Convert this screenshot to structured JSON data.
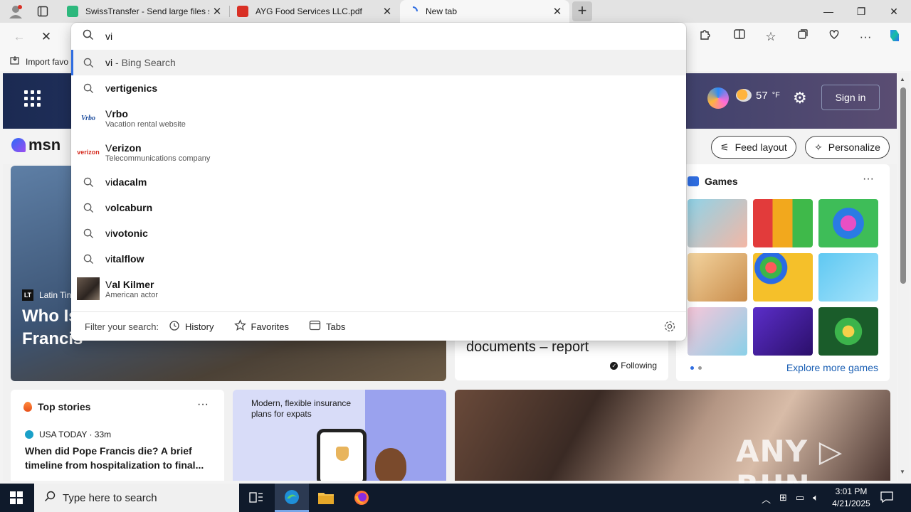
{
  "tabs": [
    {
      "title": "SwissTransfer - Send large files se",
      "close": "✕"
    },
    {
      "title": "AYG Food Services LLC.pdf",
      "close": "✕"
    },
    {
      "title": "New tab",
      "close": "✕"
    }
  ],
  "new_tab_glyph": "+",
  "window_controls": {
    "minimize": "—",
    "maximize": "❐",
    "close": "✕"
  },
  "favorites_bar": {
    "import_label": "Import favo"
  },
  "omnibox": {
    "value": "vi",
    "suggestions": [
      {
        "kind": "search",
        "bold": "vi",
        "rest": " - Bing Search"
      },
      {
        "kind": "search",
        "prefix": "v",
        "bold": "ertigenics"
      },
      {
        "kind": "site",
        "prefix": "V",
        "bold": "rbo",
        "sub": "Vacation rental website",
        "brand": "Vrbo"
      },
      {
        "kind": "site",
        "prefix": "V",
        "bold": "erizon",
        "sub": "Telecommunications company",
        "brand": "verizon"
      },
      {
        "kind": "search",
        "prefix": "vi",
        "bold": "dacalm"
      },
      {
        "kind": "search",
        "prefix": "v",
        "bold": "olcaburn"
      },
      {
        "kind": "search",
        "prefix": "vi",
        "bold": "votonic"
      },
      {
        "kind": "search",
        "prefix": "vi",
        "bold": "talflow"
      },
      {
        "kind": "person",
        "prefix": "V",
        "bold": "al Kilmer",
        "sub": "American actor"
      }
    ],
    "filter": {
      "label": "Filter your search:",
      "history": "History",
      "favorites": "Favorites",
      "tabs": "Tabs"
    }
  },
  "msn": {
    "logo": "msn",
    "weather": "57",
    "weather_unit": "°F",
    "sign_in": "Sign in",
    "feed_layout": "Feed layout",
    "personalize": "Personalize",
    "hero": {
      "source": "Latin Tin",
      "headline": "Who Is ... Preferred Candidate To Succeed Pope Francis"
    },
    "mid_card": {
      "title": "documents – report",
      "following": "Following"
    },
    "games": {
      "title": "Games",
      "more": "···",
      "explore": "Explore more games"
    },
    "top_stories": {
      "title": "Top stories",
      "more": "···",
      "source": "USA TODAY · 33m",
      "headline": "When did Pope Francis die? A brief timeline from hospitalization to final..."
    },
    "ad": {
      "text": "Modern, flexible insurance plans for expats"
    },
    "watermark": "ANY ▷ RUN"
  },
  "taskbar": {
    "search_placeholder": "Type here to search",
    "time": "3:01 PM",
    "date": "4/21/2025"
  },
  "colors": {
    "accent": "#2f6de1",
    "taskbar": "#0f1a2b",
    "link": "#1a5fb4"
  }
}
